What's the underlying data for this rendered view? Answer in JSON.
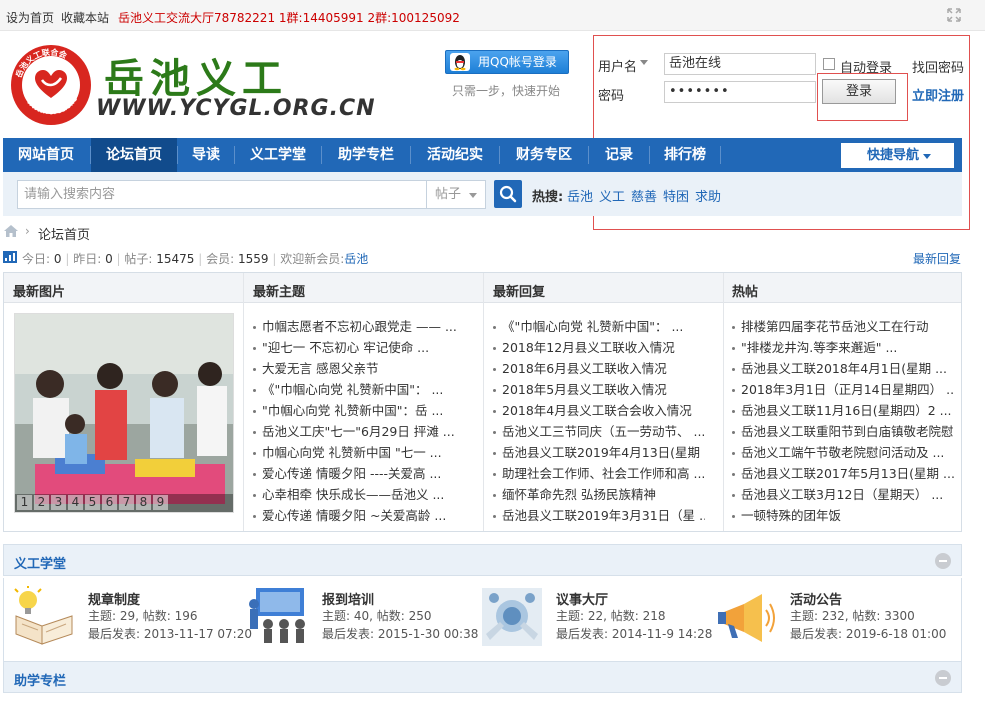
{
  "topbar": {
    "set_home": "设为首页",
    "bookmark": "收藏本站",
    "notice": "岳池义工交流大厅78782221 1群:14405991 2群:100125092"
  },
  "header": {
    "site_title": "岳池义工",
    "site_url": "WWW.YCYGL.ORG.CN",
    "logo_arc_text": "岳池义工联合会",
    "logo_bottom_text": "WWW.YCYGL.ORG",
    "qq_login": "用QQ帐号登录",
    "qq_hint": "只需一步，快速开始"
  },
  "login": {
    "username_label": "用户名",
    "username_value": "岳池在线",
    "password_label": "密码",
    "password_value": "•••••••",
    "auto_login": "自动登录",
    "forgot": "找回密码",
    "login_btn": "登录",
    "register": "立即注册"
  },
  "nav": {
    "items": [
      "网站首页",
      "论坛首页",
      "导读",
      "义工学堂",
      "助学专栏",
      "活动纪实",
      "财务专区",
      "记录",
      "排行榜"
    ],
    "quick_nav": "快捷导航"
  },
  "search": {
    "placeholder": "请输入搜索内容",
    "type": "帖子",
    "hot_label": "热搜:",
    "hot_words": [
      "岳池",
      "义工",
      "慈善",
      "特困",
      "求助"
    ]
  },
  "breadcrumb": {
    "current": "论坛首页",
    "sep": "›"
  },
  "stats": {
    "today_label": "今日:",
    "today": "0",
    "yesterday_label": "昨日:",
    "yesterday": "0",
    "posts_label": "帖子:",
    "posts": "15475",
    "members_label": "会员:",
    "members": "1559",
    "welcome_label": "欢迎新会员:",
    "new_member": "岳池",
    "latest_reply": "最新回复"
  },
  "recent": {
    "titles": [
      "最新图片",
      "最新主题",
      "最新回复",
      "热帖"
    ],
    "pager": [
      "1",
      "2",
      "3",
      "4",
      "5",
      "6",
      "7",
      "8",
      "9"
    ],
    "latest_topics": [
      "巾帼志愿者不忘初心跟党走 —— ...",
      "\"迎七一 不忘初心 牢记使命 ...",
      "大爱无言 感恩父亲节",
      "《\"巾帼心向党 礼赞新中国\"： ...",
      "\"巾帼心向党 礼赞新中国\"：岳 ...",
      "岳池义工庆\"七一\"6月29日 抨滩 ...",
      "巾帼心向党 礼赞新中国 \"七一 ...",
      "爱心传递 情暖夕阳 ----关爱高 ...",
      "心幸相牵 快乐成长——岳池义 ...",
      "爱心传递 情暖夕阳 ~关爱高龄 ..."
    ],
    "latest_replies": [
      "《\"巾帼心向党 礼赞新中国\"： ...",
      "2018年12月县义工联收入情况",
      "2018年6月县义工联收入情况",
      "2018年5月县义工联收入情况",
      "2018年4月县义工联合会收入情况",
      "岳池义工三节同庆（五一劳动节、 ...",
      "岳池县义工联2019年4月13日(星期 ...",
      "助理社会工作师、社会工作师和高 ...",
      "缅怀革命先烈 弘扬民族精神",
      "岳池县义工联2019年3月31日（星 ..."
    ],
    "hot_posts": [
      "排楼第四届李花节岳池义工在行动",
      "\"排楼龙井沟.等李来邂逅\" ...",
      "岳池县义工联2018年4月1日(星期 ...",
      "2018年3月1日（正月14日星期四） ...",
      "岳池县义工联11月16日(星期四）2 ...",
      "岳池县义工联重阳节到白庙镇敬老院慰 ...",
      "岳池义工端午节敬老院慰问活动及 ...",
      "岳池县义工联2017年5月13日(星期 ...",
      "岳池县义工联3月12日（星期天） ...",
      "一顿特殊的团年饭"
    ]
  },
  "sections": {
    "school_title": "义工学堂",
    "aid_title": "助学专栏"
  },
  "forums": [
    {
      "name": "规章制度",
      "topics": "主题: 29, 帖数: 196",
      "last": "最后发表: 2013-11-17 07:20"
    },
    {
      "name": "报到培训",
      "topics": "主题: 40, 帖数: 250",
      "last": "最后发表: 2015-1-30 00:38"
    },
    {
      "name": "议事大厅",
      "topics": "主题: 22, 帖数: 218",
      "last": "最后发表: 2014-11-9 14:28"
    },
    {
      "name": "活动公告",
      "topics": "主题: 232, 帖数: 3300",
      "last": "最后发表: 2019-6-18 01:00"
    }
  ],
  "colors": {
    "nav_blue": "#2168b7",
    "brand_green": "#2c7a19",
    "logo_red": "#d8261f",
    "highlight_red": "#e0504f"
  }
}
